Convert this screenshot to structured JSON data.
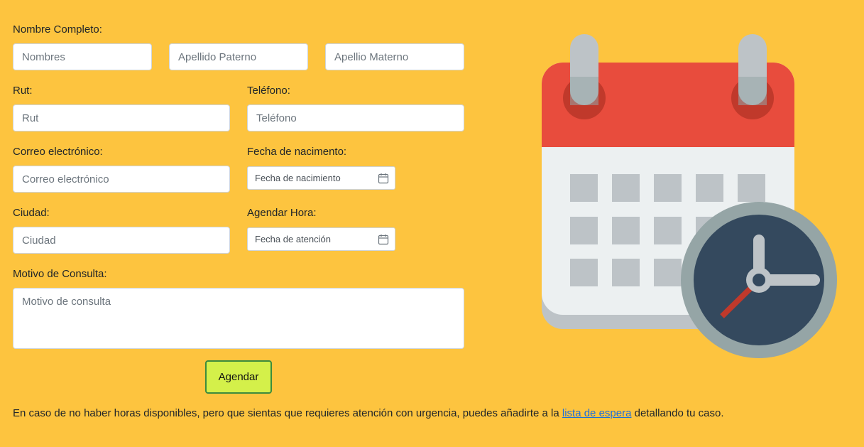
{
  "form": {
    "full_name": {
      "label": "Nombre Completo:",
      "first_names_placeholder": "Nombres",
      "paternal_surname_placeholder": "Apellido Paterno",
      "maternal_surname_placeholder": "Apellio Materno"
    },
    "rut": {
      "label": "Rut:",
      "placeholder": "Rut"
    },
    "phone": {
      "label": "Teléfono:",
      "placeholder": "Teléfono"
    },
    "email": {
      "label": "Correo electrónico:",
      "placeholder": "Correo electrónico"
    },
    "birth_date": {
      "label": "Fecha de nacimento:",
      "placeholder": "Fecha de nacimiento"
    },
    "city": {
      "label": "Ciudad:",
      "placeholder": "Ciudad"
    },
    "appointment": {
      "label": "Agendar Hora:",
      "placeholder": "Fecha de atención"
    },
    "reason": {
      "label": "Motivo de Consulta:",
      "placeholder": "Motivo de consulta"
    },
    "submit_label": "Agendar"
  },
  "footer": {
    "text_before": "En caso de no haber horas disponibles, pero que sientas que requieres atención con urgencia, puedes añadirte a la ",
    "link_text": "lista de espera",
    "text_after": " detallando tu caso."
  },
  "illustration": {
    "icon": "calendar-clock-icon",
    "colors": {
      "background": "#fdc43f",
      "calendar_header": "#e84c3d",
      "calendar_body": "#ecf0f1",
      "calendar_shadow": "#bdc3c7",
      "ring": "#bdc3c7",
      "clock_rim": "#95a5a6",
      "clock_face": "#34495e",
      "clock_hand_red": "#c0392b",
      "button_green": "#d4f04a"
    }
  }
}
